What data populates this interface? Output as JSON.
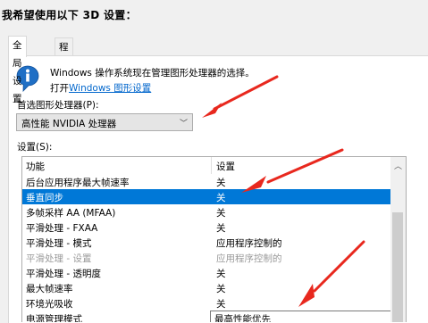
{
  "heading": "我希望使用以下 3D 设置：",
  "tabs": [
    {
      "label": "全局设置",
      "active": true
    },
    {
      "label": "程序设置",
      "active": false
    }
  ],
  "info": {
    "line1": "Windows 操作系统现在管理图形处理器的选择。",
    "line2_prefix": "打开",
    "line2_link": "Windows 图形设置"
  },
  "gpu": {
    "label": "首选图形处理器(P):",
    "value": "高性能 NVIDIA 处理器"
  },
  "settings": {
    "label": "设置(S):",
    "headers": {
      "feature": "功能",
      "setting": "设置"
    },
    "rows": [
      {
        "feature": "后台应用程序最大帧速率",
        "setting": "关"
      },
      {
        "feature": "垂直同步",
        "setting": "关",
        "selected": true
      },
      {
        "feature": "多帧采样 AA (MFAA)",
        "setting": "关"
      },
      {
        "feature": "平滑处理 - FXAA",
        "setting": "关"
      },
      {
        "feature": "平滑处理 - 模式",
        "setting": "应用程序控制的"
      },
      {
        "feature": "平滑处理 - 设置",
        "setting": "应用程序控制的",
        "disabled": true
      },
      {
        "feature": "平滑处理 - 透明度",
        "setting": "关"
      },
      {
        "feature": "最大帧速率",
        "setting": "关"
      },
      {
        "feature": "环境光吸收",
        "setting": "关"
      },
      {
        "feature": "电源管理模式",
        "setting": "最高性能优先",
        "combo": true
      }
    ]
  },
  "colors": {
    "selection": "#0078d7",
    "link": "#0066cc",
    "annotation_arrow": "#e8281e"
  },
  "icons": {
    "info": "info-icon",
    "dropdown": "chevron-down-icon",
    "scroll_up": "chevron-up-icon"
  }
}
